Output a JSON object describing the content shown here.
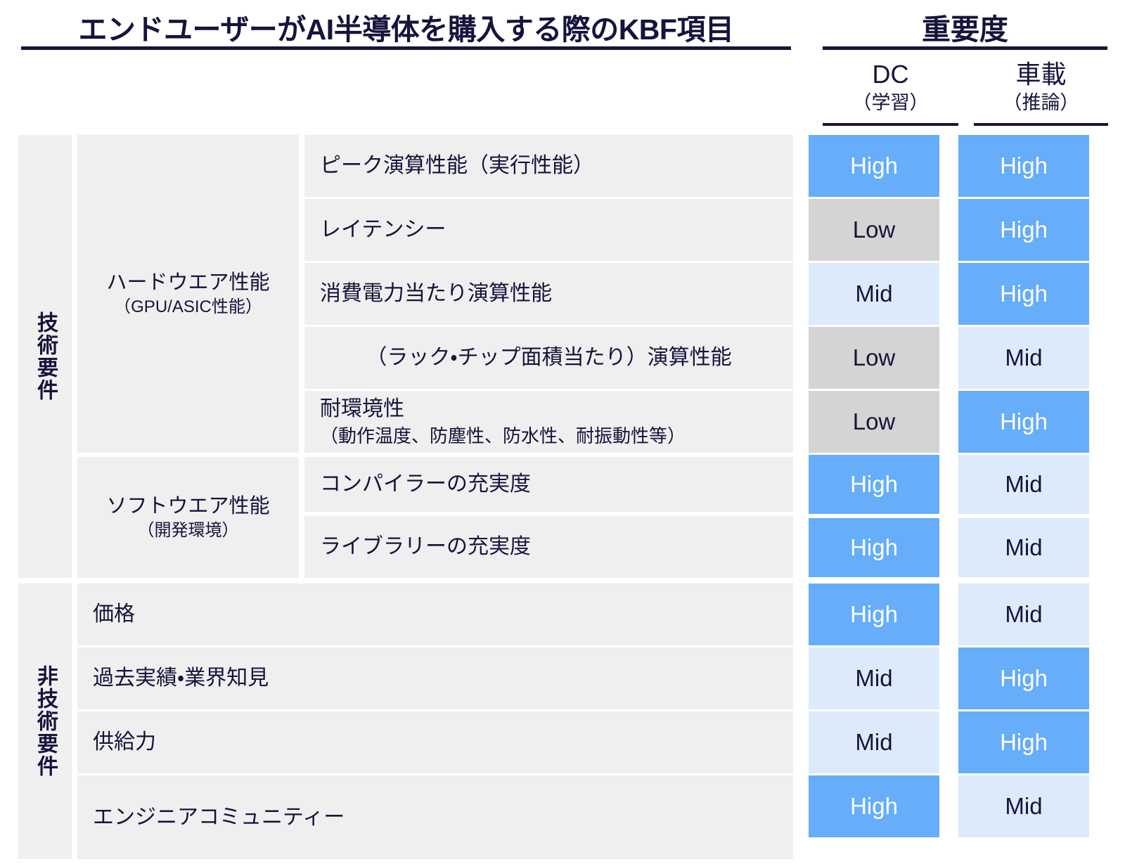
{
  "header": {
    "main_title": "エンドユーザーがAI半導体を購入する際のKBF項目",
    "importance_title": "重要度",
    "columns": [
      {
        "name": "DC",
        "sub": "（学習）"
      },
      {
        "name": "車載",
        "sub": "（推論）"
      }
    ]
  },
  "categories": [
    {
      "key": "tech",
      "label": "技術要件"
    },
    {
      "key": "nontech",
      "label": "非技術要件"
    }
  ],
  "groups": [
    {
      "key": "hw",
      "main": "ハードウエア性能",
      "sub": "（GPU/ASIC性能）"
    },
    {
      "key": "sw",
      "main": "ソフトウエア性能",
      "sub": "（開発環境）"
    }
  ],
  "legend": {
    "high": "High",
    "mid": "Mid",
    "low": "Low"
  },
  "colors": {
    "high": "#66adfa",
    "mid": "#ddeafc",
    "low": "#d4d4d4",
    "ink": "#14143c",
    "row_bg": "#efefef",
    "category_bg": "#f0f0f0"
  },
  "rows": [
    {
      "category": "技術要件",
      "group": "ハードウエア性能",
      "item": "ピーク演算性能（実行性能）",
      "item_sub": "",
      "dc": "High",
      "dc_level": "high",
      "auto": "High",
      "auto_level": "high"
    },
    {
      "category": "技術要件",
      "group": "ハードウエア性能",
      "item": "レイテンシー",
      "item_sub": "",
      "dc": "Low",
      "dc_level": "low",
      "auto": "High",
      "auto_level": "high"
    },
    {
      "category": "技術要件",
      "group": "ハードウエア性能",
      "item": "消費電力当たり演算性能",
      "item_sub": "",
      "dc": "Mid",
      "dc_level": "mid",
      "auto": "High",
      "auto_level": "high"
    },
    {
      "category": "技術要件",
      "group": "ハードウエア性能",
      "item": "（ラック・チップ面積当たり）演算性能",
      "item_sub": "",
      "dc": "Low",
      "dc_level": "low",
      "auto": "Mid",
      "auto_level": "mid"
    },
    {
      "category": "技術要件",
      "group": "ハードウエア性能",
      "item": "耐環境性",
      "item_sub": "（動作温度、防塵性、防水性、耐振動性等）",
      "dc": "Low",
      "dc_level": "low",
      "auto": "High",
      "auto_level": "high"
    },
    {
      "category": "技術要件",
      "group": "ソフトウエア性能",
      "item": "コンパイラーの充実度",
      "item_sub": "",
      "dc": "High",
      "dc_level": "high",
      "auto": "Mid",
      "auto_level": "mid"
    },
    {
      "category": "技術要件",
      "group": "ソフトウエア性能",
      "item": "ライブラリーの充実度",
      "item_sub": "",
      "dc": "High",
      "dc_level": "high",
      "auto": "Mid",
      "auto_level": "mid"
    },
    {
      "category": "非技術要件",
      "group": "",
      "item": "価格",
      "item_sub": "",
      "dc": "High",
      "dc_level": "high",
      "auto": "Mid",
      "auto_level": "mid"
    },
    {
      "category": "非技術要件",
      "group": "",
      "item": "過去実績・業界知見",
      "item_sub": "",
      "dc": "Mid",
      "dc_level": "mid",
      "auto": "High",
      "auto_level": "high"
    },
    {
      "category": "非技術要件",
      "group": "",
      "item": "供給力",
      "item_sub": "",
      "dc": "Mid",
      "dc_level": "mid",
      "auto": "High",
      "auto_level": "high"
    },
    {
      "category": "非技術要件",
      "group": "",
      "item": "エンジニアコミュニティー",
      "item_sub": "",
      "dc": "High",
      "dc_level": "high",
      "auto": "Mid",
      "auto_level": "mid"
    }
  ]
}
